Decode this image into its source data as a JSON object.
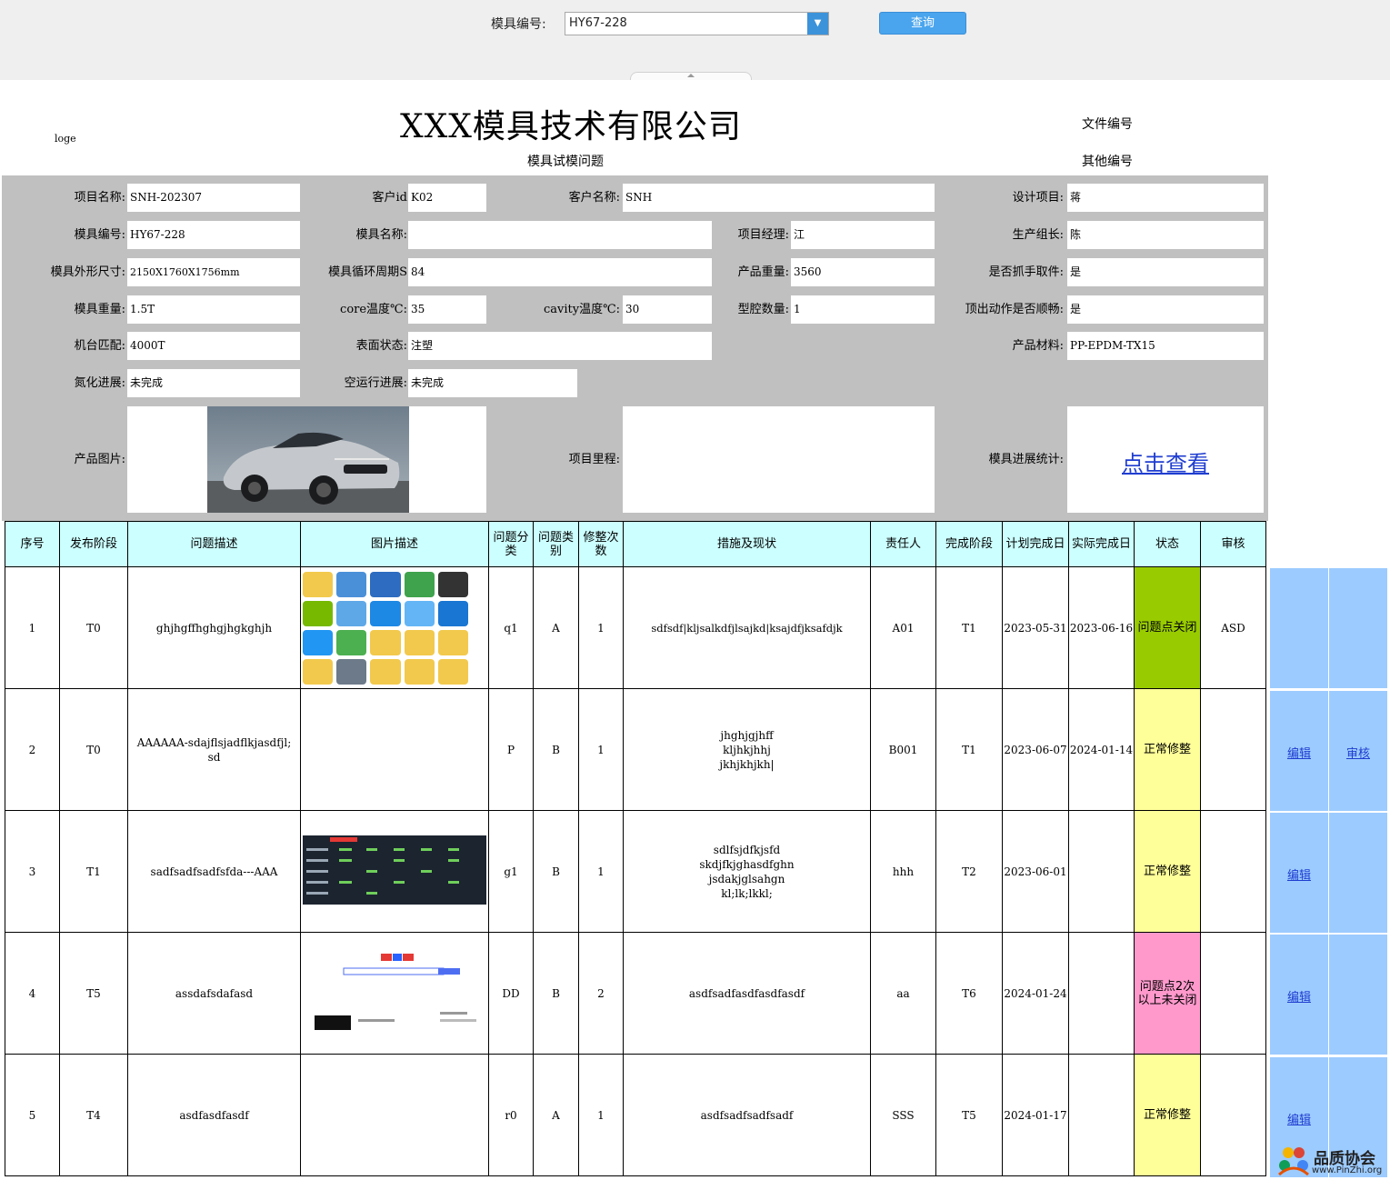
{
  "query": {
    "label": "模具编号:",
    "mold_value": "HY67-228",
    "button": "查询"
  },
  "header": {
    "logo": "loge",
    "company": "XXX模具技术有限公司",
    "subtitle": "模具试模问题",
    "doc_no_label": "文件编号",
    "other_no_label": "其他编号"
  },
  "form": {
    "project_name_label": "项目名称:",
    "project_name": "SNH-202307",
    "customer_id_label": "客户id",
    "customer_id": "K02",
    "customer_name_label": "客户名称:",
    "customer_name": "SNH",
    "design_label": "设计项目:",
    "design": "蒋",
    "mold_no_label": "模具编号:",
    "mold_no": "HY67-228",
    "mold_name_label": "模具名称:",
    "mold_name": "",
    "pm_label": "项目经理:",
    "pm": "江",
    "prod_leader_label": "生产组长:",
    "prod_leader": "陈",
    "size_label": "模具外形尺寸:",
    "size": "2150X1760X1756mm",
    "cycle_label": "模具循环周期S",
    "cycle": "84",
    "product_weight_label": "产品重量:",
    "product_weight": "3560",
    "grab_label": "是否抓手取件:",
    "grab": "是",
    "mold_weight_label": "模具重量:",
    "mold_weight": "1.5T",
    "core_temp_label": "core温度℃:",
    "core_temp": "35",
    "cavity_temp_label": "cavity温度℃:",
    "cavity_temp": "30",
    "cavity_count_label": "型腔数量:",
    "cavity_count": "1",
    "ejection_label": "顶出动作是否顺畅:",
    "ejection": "是",
    "machine_label": "机台匹配:",
    "machine": "4000T",
    "surface_label": "表面状态:",
    "surface": "注塑",
    "material_label": "产品材料:",
    "material": "PP-EPDM-TX15",
    "nitride_label": "氮化进展:",
    "nitride": "未完成",
    "dryrun_label": "空运行进展:",
    "dryrun": "未完成",
    "product_image_label": "产品图片:",
    "milestone_label": "项目里程:",
    "progress_label": "模具进展统计:",
    "progress_link": "点击查看"
  },
  "table": {
    "headers": [
      "序号",
      "发布阶段",
      "问题描述",
      "图片描述",
      "问题分类",
      "问题类别",
      "修整次数",
      "措施及现状",
      "责任人",
      "完成阶段",
      "计划完成日",
      "实际完成日",
      "状态",
      "审核"
    ],
    "rows": [
      {
        "no": "1",
        "stage": "T0",
        "desc": "ghjhgffhghgjhgkghjh",
        "cls": "q1",
        "cat": "A",
        "times": "1",
        "measure": "sdfsdf|kljsalkdfjlsajkd|ksajdfjksafdjk",
        "owner": "A01",
        "done_stage": "T1",
        "plan": "2023-05-31",
        "actual": "2023-06-16",
        "status": "问题点关闭",
        "review": "ASD",
        "edit": "",
        "audit": ""
      },
      {
        "no": "2",
        "stage": "T0",
        "desc": "AAAAAA-sdajflsjadflkjasdfjl;sd",
        "cls": "P",
        "cat": "B",
        "times": "1",
        "measure": "jhghjgjhff kljhkjhhj jkhjkhjkh|",
        "owner": "B001",
        "done_stage": "T1",
        "plan": "2023-06-07",
        "actual": "2024-01-14",
        "status": "正常修整",
        "review": "",
        "edit": "编辑",
        "audit": "审核"
      },
      {
        "no": "3",
        "stage": "T1",
        "desc": "sadfsadfsadfsfda---AAA",
        "cls": "g1",
        "cat": "B",
        "times": "1",
        "measure": "sdlfsjdfkjsfd skdjfkjghasdfghn jsdakjglsahgn kl;lk;lkkl;",
        "owner": "hhh",
        "done_stage": "T2",
        "plan": "2023-06-01",
        "actual": "",
        "status": "正常修整",
        "review": "",
        "edit": "编辑",
        "audit": ""
      },
      {
        "no": "4",
        "stage": "T5",
        "desc": "assdafsdafasd",
        "cls": "DD",
        "cat": "B",
        "times": "2",
        "measure": "asdfsadfasdfasdfasdf",
        "owner": "aa",
        "done_stage": "T6",
        "plan": "2024-01-24",
        "actual": "",
        "status": "问题点2次以上未关闭",
        "review": "",
        "edit": "编辑",
        "audit": ""
      },
      {
        "no": "5",
        "stage": "T4",
        "desc": "asdfasdfasdf",
        "cls": "r0",
        "cat": "A",
        "times": "1",
        "measure": "asdfsadfsadfsadf",
        "owner": "SSS",
        "done_stage": "T5",
        "plan": "2024-01-17",
        "actual": "",
        "status": "正常修整",
        "review": "",
        "edit": "编辑",
        "audit": ""
      }
    ]
  },
  "colors": {
    "status_closed": "#99cc00",
    "status_normal": "#ffff99",
    "status_overdue": "#ff99cc",
    "side_panel": "#9ccbff",
    "header_bg": "#ccffff",
    "form_bg": "#c0c0c0"
  },
  "watermark": {
    "name": "品质协会",
    "url": "www.PinZhi.org"
  }
}
